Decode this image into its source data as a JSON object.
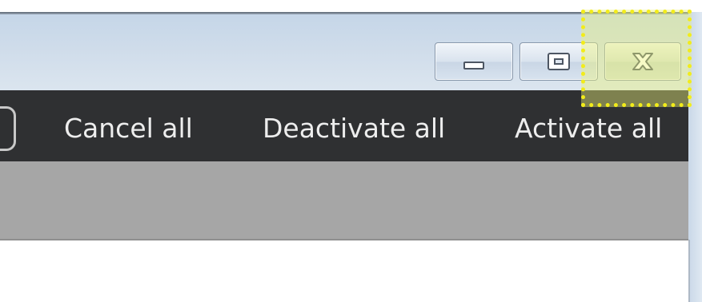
{
  "window": {
    "controls": {
      "minimize": "minimize",
      "maximize": "maximize",
      "close": "close"
    }
  },
  "toolbar": {
    "items": [
      {
        "label": "Cancel all"
      },
      {
        "label": "Deactivate all"
      },
      {
        "label": "Activate all"
      }
    ]
  },
  "colors": {
    "toolbar_bg": "#2f3032",
    "toolbar_text": "#ededed",
    "titlebar_bg": "#cfdcea",
    "gray_band": "#a6a6a6",
    "highlight": "#f2ec1a"
  }
}
